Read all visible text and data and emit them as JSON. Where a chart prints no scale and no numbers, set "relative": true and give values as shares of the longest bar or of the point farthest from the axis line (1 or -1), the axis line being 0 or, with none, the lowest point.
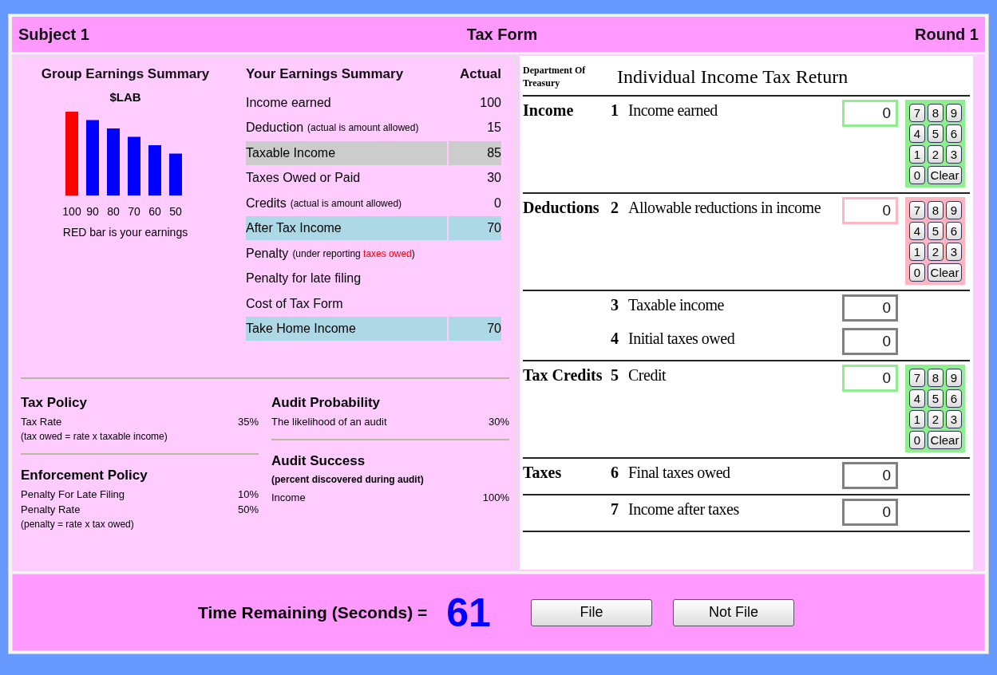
{
  "header": {
    "subject": "Subject 1",
    "title": "Tax Form",
    "round": "Round 1"
  },
  "group_summary": {
    "title": "Group Earnings Summary",
    "subtitle": "$LAB",
    "caption": "RED bar is your earnings",
    "chart_data": {
      "type": "bar",
      "relative": true,
      "categories": [
        "100",
        "90",
        "80",
        "70",
        "60",
        "50"
      ],
      "series": [
        {
          "colors": [
            "#ff0000",
            "#0000ff",
            "#0000ff",
            "#0000ff",
            "#0000ff",
            "#0000ff"
          ],
          "values": [
            1.0,
            0.9,
            0.8,
            0.7,
            0.6,
            0.5
          ]
        }
      ]
    }
  },
  "earnings": {
    "title": "Your Earnings Summary",
    "value_header": "Actual",
    "rows": [
      {
        "label": "Income earned",
        "value": "100"
      },
      {
        "label": "Deduction",
        "note": [
          {
            "text": "(actual is amount allowed)",
            "alert": false
          }
        ],
        "value": "15"
      },
      {
        "label": "Taxable Income",
        "value": "85",
        "color": "#cccccc"
      },
      {
        "label": "Taxes Owed or Paid",
        "value": "30"
      },
      {
        "label": "Credits",
        "note": [
          {
            "text": "(actual is amount allowed)",
            "alert": false
          }
        ],
        "value": "0"
      },
      {
        "label": "After Tax Income",
        "value": "70",
        "color": "#add8e6"
      },
      {
        "label": "Penalty",
        "note": [
          {
            "text": "(under reporting ",
            "alert": false
          },
          {
            "text": "taxes owed",
            "alert": true
          },
          {
            "text": ")",
            "alert": false
          }
        ]
      },
      {
        "label": "Penalty for late filing"
      },
      {
        "label": "Cost of Tax Form"
      },
      {
        "label": "Take Home Income",
        "value": "70",
        "color": "#add8e6"
      }
    ]
  },
  "policies": {
    "left": [
      {
        "title": "Tax Policy",
        "items": [
          {
            "label": "Tax Rate",
            "value": "35%",
            "note": "(tax owed = rate x taxable income)"
          }
        ]
      },
      {
        "title": "Enforcement Policy",
        "items": [
          {
            "label": "Penalty For Late Filing",
            "value": "10%"
          },
          {
            "label": "Penalty Rate",
            "value": "50%",
            "note": "(penalty = rate x tax owed)"
          }
        ]
      }
    ],
    "right": [
      {
        "title": "Audit Probability",
        "items": [
          {
            "label": "The likelihood of an audit",
            "value": "30%"
          }
        ]
      },
      {
        "title": "Audit Success",
        "subtitle": "(percent discovered during audit)",
        "items": [
          {
            "label": "Income",
            "value": "100%"
          }
        ]
      }
    ]
  },
  "form": {
    "agency": "Department Of Treasury",
    "title": "Individual Income Tax Return",
    "sections": [
      {
        "heading": "Income",
        "lines": [
          {
            "number": "1",
            "label": "Income earned",
            "value": "0",
            "color": "#90ee90"
          }
        ],
        "keypad": {
          "color": "#90ee90",
          "keys": [
            "7",
            "8",
            "9",
            "4",
            "5",
            "6",
            "1",
            "2",
            "3",
            "0",
            "Clear"
          ]
        }
      },
      {
        "heading": "Deductions",
        "lines": [
          {
            "number": "2",
            "label": "Allowable reductions in income",
            "value": "0",
            "color": "#ffb6c1"
          }
        ],
        "keypad": {
          "color": "#ffb6c1",
          "keys": [
            "7",
            "8",
            "9",
            "4",
            "5",
            "6",
            "1",
            "2",
            "3",
            "0",
            "Clear"
          ]
        }
      },
      {
        "lines": [
          {
            "number": "3",
            "label": "Taxable income",
            "value": "0",
            "color": "#808080"
          },
          {
            "number": "4",
            "label": "Initial taxes owed",
            "value": "0",
            "color": "#808080"
          }
        ]
      },
      {
        "heading": "Tax Credits",
        "lines": [
          {
            "number": "5",
            "label": "Credit",
            "value": "0",
            "color": "#90ee90"
          }
        ],
        "keypad": {
          "color": "#90ee90",
          "keys": [
            "7",
            "8",
            "9",
            "4",
            "5",
            "6",
            "1",
            "2",
            "3",
            "0",
            "Clear"
          ]
        }
      },
      {
        "heading": "Taxes",
        "lines": [
          {
            "number": "6",
            "label": "Final taxes owed",
            "value": "0",
            "color": "#808080"
          }
        ]
      },
      {
        "lines": [
          {
            "number": "7",
            "label": "Income after taxes",
            "value": "0",
            "color": "#808080"
          }
        ]
      }
    ]
  },
  "footer": {
    "label": "Time Remaining (Seconds) =",
    "time": "61",
    "buttons": [
      "File",
      "Not File"
    ]
  }
}
